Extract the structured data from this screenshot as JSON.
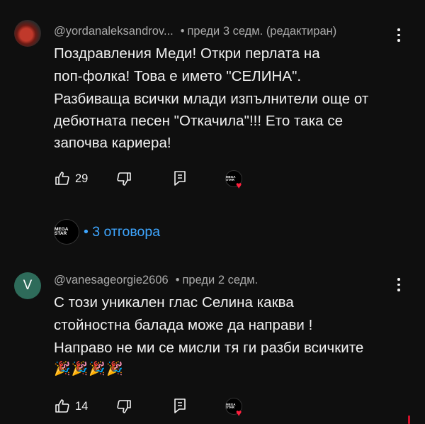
{
  "comments": [
    {
      "author": "@yordanaleksandrov...",
      "time": "преди 3 седм.",
      "edited": "(редактиран)",
      "lines": [
        "Поздравления Меди! Откри перлата на",
        "поп-фолка! Това е името \"СЕЛИНА\".",
        "Разбиваща всички млади изпълнители още от",
        "дебютната песен \"Откачила\"!!! Ето така се",
        "започва кариера!"
      ],
      "likes": "29",
      "hearted_by": "MEGA STAR",
      "replies_label": "• 3 отговора",
      "replier_badge": "MEGA STAR"
    },
    {
      "author": "@vanesageorgie2606",
      "avatar_letter": "V",
      "time": "преди 2 седм.",
      "lines": [
        "С този уникален глас Селина каква",
        "стойностна балада може да направи !",
        "Направо не ми се мисли тя ги разби всичките"
      ],
      "emoji_line": "🎉🎉🎉🎉",
      "likes": "14",
      "hearted_by": "MEGA STAR"
    }
  ],
  "icons": {
    "like": "thumbs-up-icon",
    "dislike": "thumbs-down-icon",
    "reply": "reply-icon",
    "more": "kebab-menu-icon",
    "heart": "heart-icon"
  },
  "colors": {
    "background": "#0f0f0f",
    "text": "#f1f1f1",
    "meta": "#aaaaaa",
    "link": "#3ea6ff",
    "heart": "#ff1f3d",
    "avatar_v": "#2e6b5a"
  }
}
